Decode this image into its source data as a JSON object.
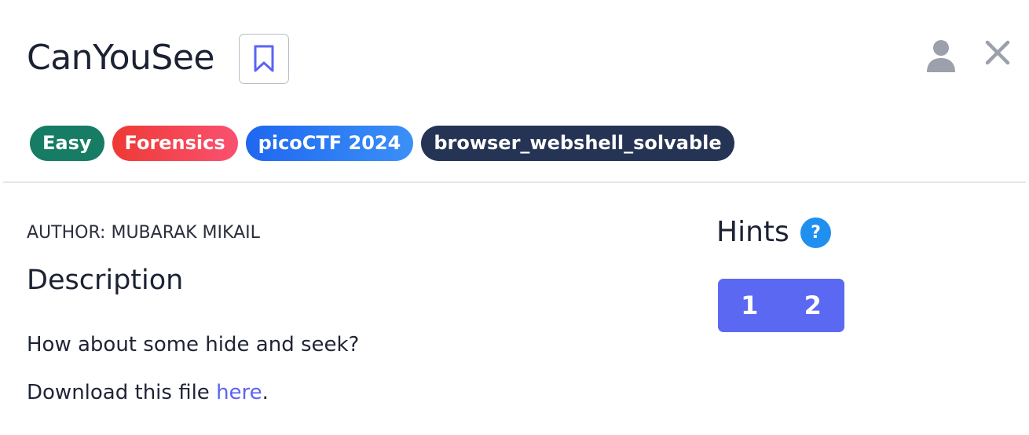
{
  "challenge": {
    "title": "CanYouSee",
    "author": "AUTHOR: MUBARAK MIKAIL",
    "description_heading": "Description",
    "description_line1": "How about some hide and seek?",
    "description_line2_prefix": "Download this file ",
    "description_link_text": "here",
    "description_line2_suffix": "."
  },
  "tags": [
    {
      "label": "Easy",
      "color": "#167c64"
    },
    {
      "label": "Forensics",
      "color": "#f04450"
    },
    {
      "label": "picoCTF 2024",
      "color": "#2a7af3"
    },
    {
      "label": "browser_webshell_solvable",
      "color": "#253454"
    }
  ],
  "hints": {
    "heading": "Hints",
    "help_symbol": "?",
    "buttons": [
      "1",
      "2"
    ]
  },
  "icons": {
    "bookmark": "bookmark-icon",
    "user": "user-icon",
    "close": "close-icon",
    "help": "question-icon"
  },
  "colors": {
    "link": "#5b63f1",
    "hint_button": "#5b69f2",
    "help_icon": "#1f8ff0",
    "bookmark_stroke": "#5b63f1",
    "user_icon": "#9ba0ab",
    "close_icon": "#9ba0ab"
  }
}
